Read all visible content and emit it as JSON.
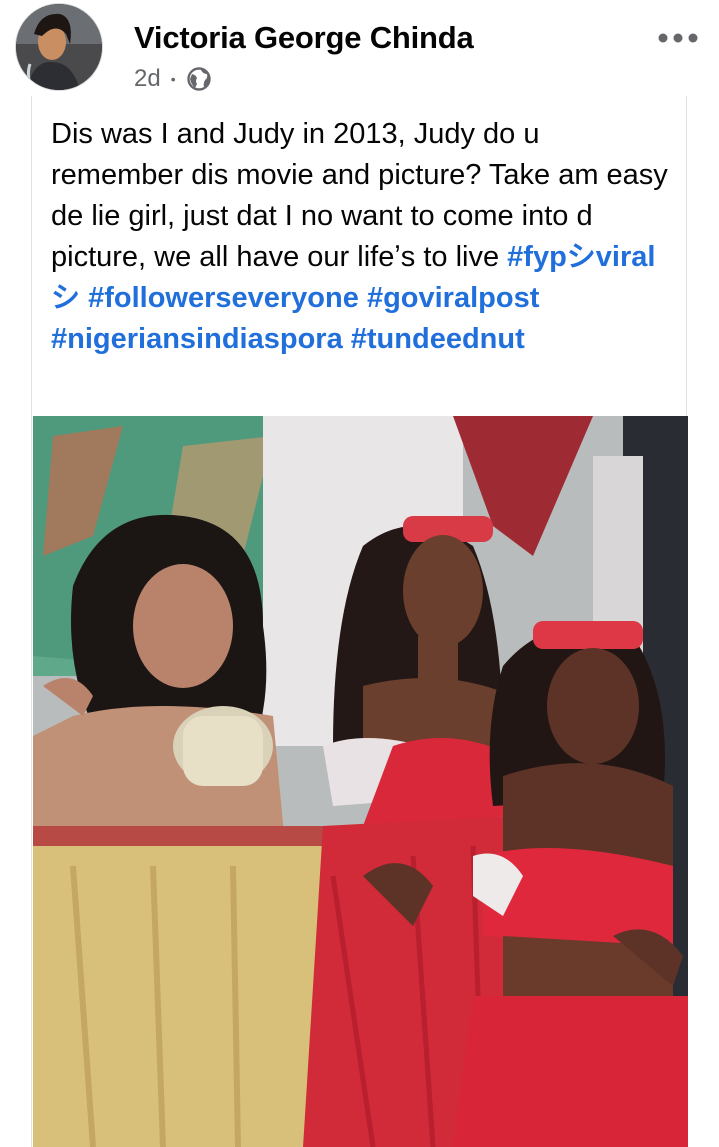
{
  "post": {
    "author": "Victoria George Chinda",
    "time": "2d",
    "separator": "•",
    "privacy_icon": "globe-icon",
    "more_icon": "more-options-icon",
    "text": "Dis was I and Judy in 2013, Judy do u remember dis movie and picture? Take am easy de lie girl, just dat I no want to come into d picture, we all have our lifeʼs to live",
    "hashtags": [
      "#fypシviralシ",
      "#followerseveryone",
      "#goviralpost",
      "#nigeriansindiaspora",
      "#tundeednut"
    ],
    "colors": {
      "hashtag": "#216fdb",
      "text": "#050505",
      "secondary": "#65676b"
    }
  }
}
